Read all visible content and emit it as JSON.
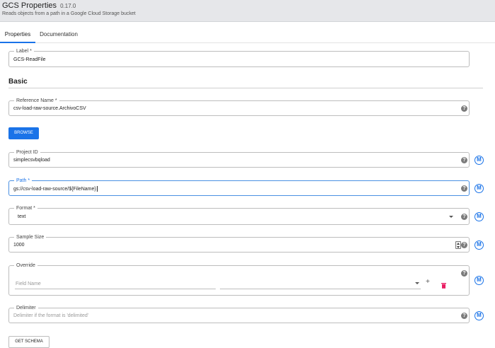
{
  "header": {
    "title": "GCS Properties",
    "version": "0.17.0",
    "description": "Reads objects from a path in a Google Cloud Storage bucket"
  },
  "tabs": [
    {
      "label": "Properties",
      "active": true
    },
    {
      "label": "Documentation",
      "active": false
    }
  ],
  "fields": {
    "label": {
      "label": "Label *",
      "value": "GCS-ReadFile"
    },
    "section_basic": "Basic",
    "reference_name": {
      "label": "Reference Name *",
      "value": "csv-load-raw-source.ArchivoCSV"
    },
    "browse_button": "BROWSE",
    "project_id": {
      "label": "Project ID",
      "value": "simplecsvbqload"
    },
    "path": {
      "label": "Path *",
      "value": "gs://csv-load-raw-source/${FileName}"
    },
    "format": {
      "label": "Format *",
      "value": "text"
    },
    "sample_size": {
      "label": "Sample Size",
      "value": "1000"
    },
    "override": {
      "label": "Override",
      "field_name_placeholder": "Field Name"
    },
    "delimiter": {
      "label": "Delimiter",
      "placeholder": "Delimiter if the format is 'delimited'"
    },
    "get_schema_button": "GET SCHEMA"
  },
  "icons": {
    "help": "?",
    "macro": "M",
    "add": "+",
    "delete": "trash-icon"
  },
  "colors": {
    "accent": "#1a73e8",
    "delete": "#e91e63",
    "help": "#7b7b7b"
  }
}
